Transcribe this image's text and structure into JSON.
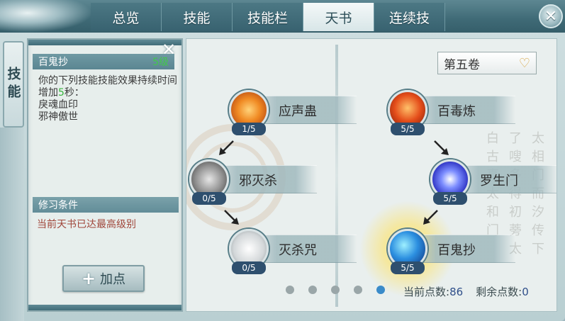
{
  "tabs": [
    {
      "label": "总览"
    },
    {
      "label": "技能"
    },
    {
      "label": "技能栏"
    },
    {
      "label": "天书",
      "active": true
    },
    {
      "label": "连续技"
    }
  ],
  "side_tab": {
    "label": "技能"
  },
  "close_icon": "close-icon",
  "info_panel": {
    "skill_name": "百鬼抄",
    "skill_level": "5级",
    "desc_prefix": "你的下列技能技能效果持续时间增加",
    "desc_value": "5",
    "desc_suffix": "秒：",
    "desc_skill_1": "戾魂血印",
    "desc_skill_2": "邪神傲世",
    "cond_header": "修习条件",
    "cond_text": "当前天书已达最高级别",
    "add_button": "加点"
  },
  "book_select": {
    "value": "第五卷"
  },
  "left_tree": [
    {
      "name": "应声蛊",
      "count": "1/5"
    },
    {
      "name": "邪灭杀",
      "count": "0/5"
    },
    {
      "name": "灭杀咒",
      "count": "0/5"
    }
  ],
  "right_tree": [
    {
      "name": "百毒炼",
      "count": "5/5"
    },
    {
      "name": "罗生门",
      "count": "5/5"
    },
    {
      "name": "百鬼抄",
      "count": "5/5",
      "selected": true
    }
  ],
  "pagination": {
    "total": 5,
    "active_index": 4
  },
  "points": {
    "current_label": "当前点数:",
    "current_value": "86",
    "remain_label": "剩余点数:",
    "remain_value": "0"
  },
  "colors": {
    "accent_green": "#35b53c",
    "condition_red": "#a0463a",
    "dot_active": "#3a8bc9"
  }
}
